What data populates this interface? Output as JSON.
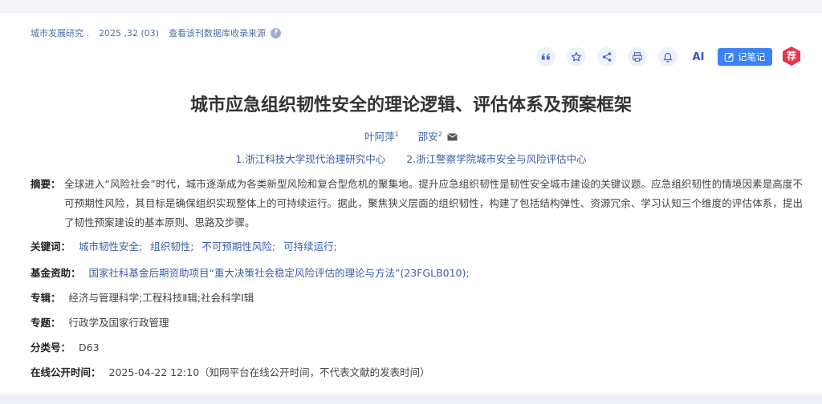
{
  "source": {
    "journal": "城市发展研究 .",
    "issue": "2025 ,32 (03)",
    "db_link": "查看该刊数据库收录来源",
    "help": "?"
  },
  "toolbar": {
    "ai_label": "AI",
    "note_label": "记笔记",
    "recommend_label": "荐"
  },
  "article": {
    "title": "城市应急组织韧性安全的理论逻辑、评估体系及预案框架",
    "authors": [
      {
        "name": "叶阿萍",
        "sup": "1"
      },
      {
        "name": "邵安",
        "sup": "2"
      }
    ],
    "affiliations": [
      "1.浙江科技大学现代治理研究中心",
      "2.浙江警察学院城市安全与风险评估中心"
    ]
  },
  "abstract": {
    "label": "摘要：",
    "text": "全球进入“风险社会”时代，城市逐渐成为各类新型风险和复合型危机的聚集地。提升应急组织韧性是韧性安全城市建设的关键议题。应急组织韧性的情境因素是高度不可预期性风险，其目标是确保组织实现整体上的可持续运行。据此，聚焦狭义层面的组织韧性，构建了包括结构弹性、资源冗余、学习认知三个维度的评估体系，提出了韧性预案建设的基本原则、思路及步骤。"
  },
  "keywords": {
    "label": "关键词：",
    "items": [
      "城市韧性安全;",
      "组织韧性;",
      "不可预期性风险;",
      "可持续运行;"
    ]
  },
  "funding": {
    "label": "基金资助：",
    "text": "国家社科基金后期资助项目“重大决策社会稳定风险评估的理论与方法”(23FGLB010);"
  },
  "series": {
    "label": "专辑：",
    "text": "经济与管理科学;工程科技Ⅱ辑;社会科学Ⅰ辑"
  },
  "topic": {
    "label": "专题：",
    "text": "行政学及国家行政管理"
  },
  "classification": {
    "label": "分类号：",
    "text": "D63"
  },
  "online_time": {
    "label": "在线公开时间：",
    "text": "2025-04-22 12:10（知网平台在线公开时间，不代表文献的发表时间）"
  },
  "colors": {
    "link": "#3b5ea8",
    "note_button": "#3b82f6",
    "recommend_badge": "#e8344e",
    "icon": "#4c64d6"
  }
}
